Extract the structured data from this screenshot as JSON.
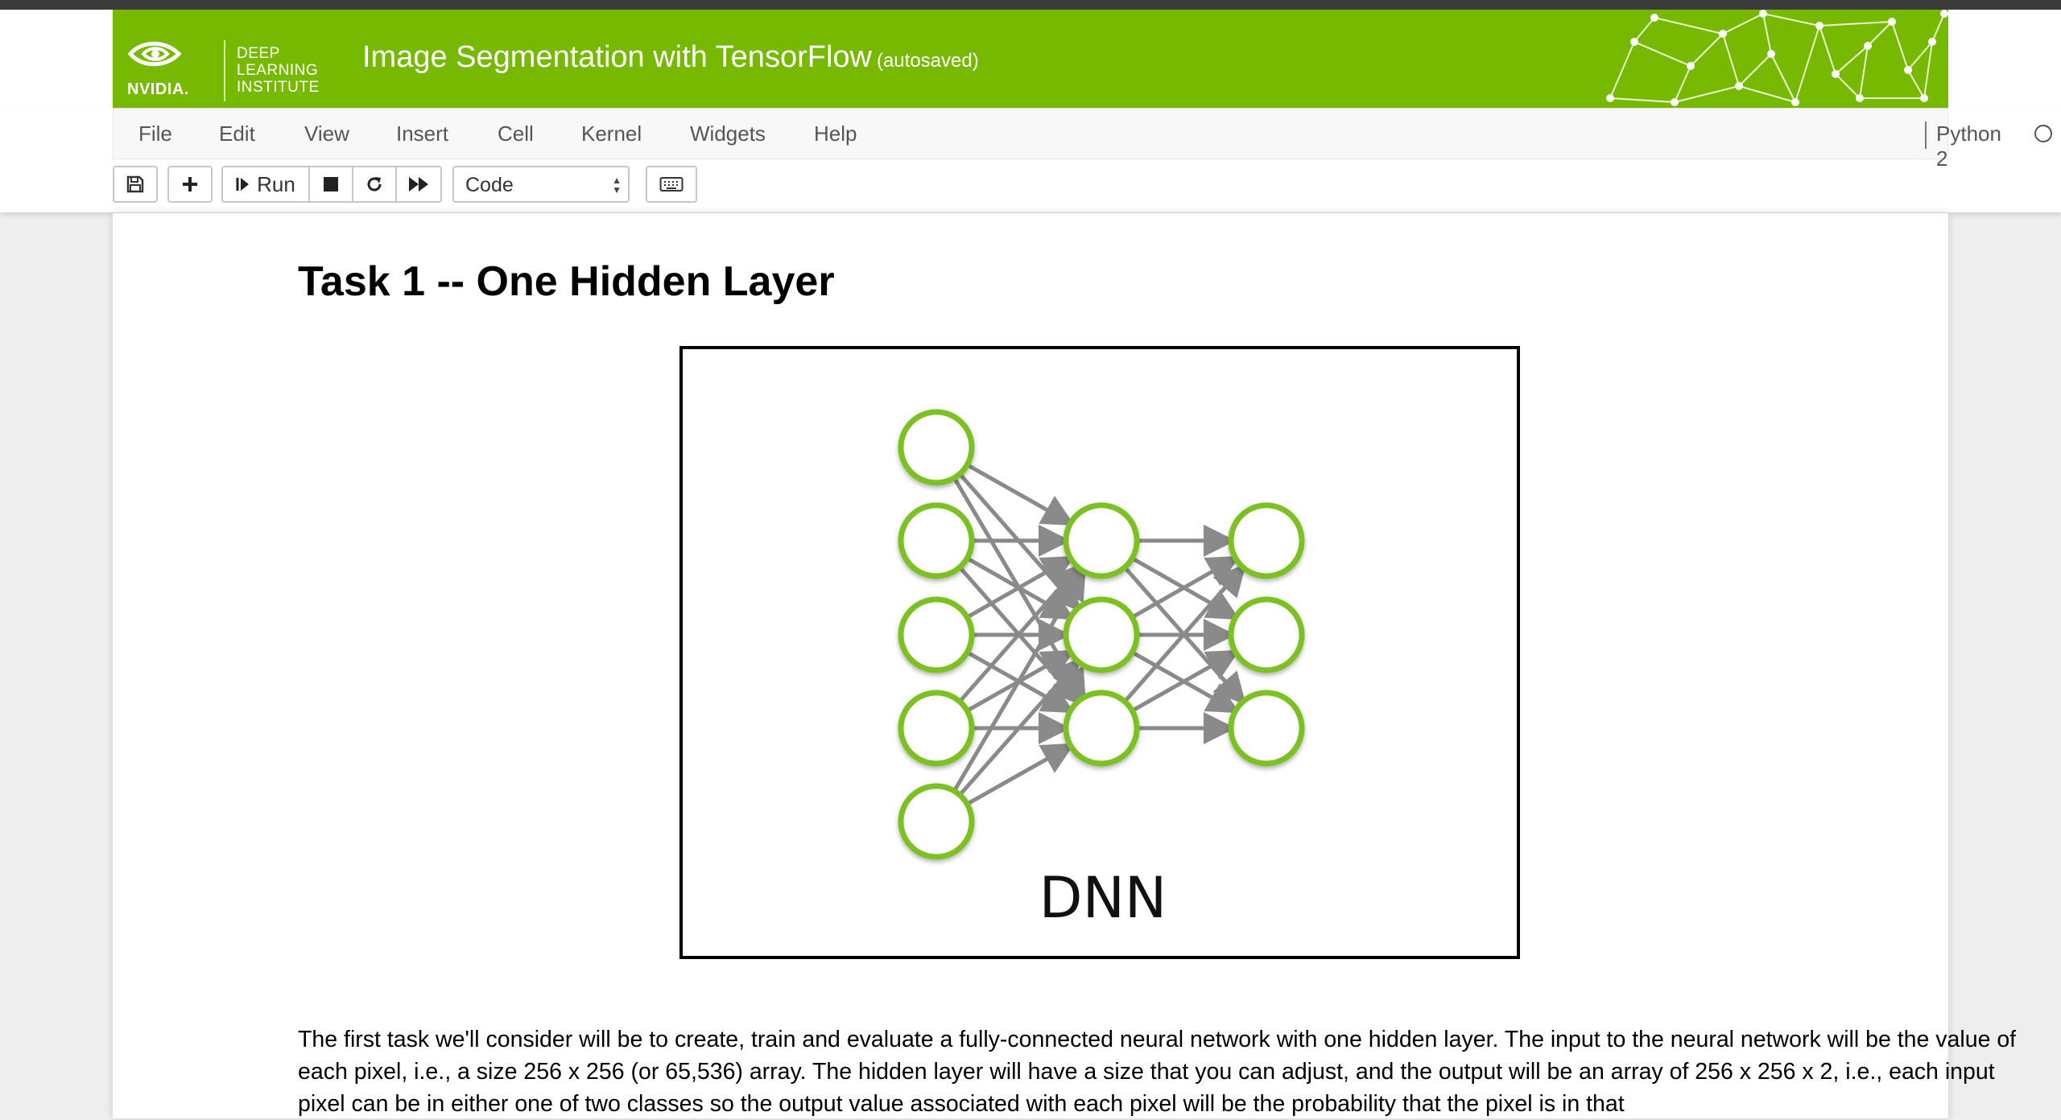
{
  "header": {
    "logo_wordmark": "NVIDIA.",
    "logo_lines": [
      "DEEP",
      "LEARNING",
      "INSTITUTE"
    ],
    "notebook_title": "Image Segmentation with TensorFlow",
    "autosave_status": "(autosaved)"
  },
  "menu": {
    "items": [
      {
        "label": "File"
      },
      {
        "label": "Edit"
      },
      {
        "label": "View"
      },
      {
        "label": "Insert"
      },
      {
        "label": "Cell"
      },
      {
        "label": "Kernel"
      },
      {
        "label": "Widgets"
      },
      {
        "label": "Help"
      }
    ],
    "kernel_name": "Python 2"
  },
  "toolbar": {
    "run_label": "Run",
    "cell_type": "Code",
    "icons": [
      "save-icon",
      "plus-icon",
      "step-forward-icon",
      "stop-icon",
      "restart-icon",
      "fast-forward-icon",
      "keyboard-icon"
    ]
  },
  "content": {
    "heading": "Task 1 -- One Hidden Layer",
    "figure_label": "DNN",
    "network_layers": [
      5,
      3,
      3
    ],
    "paragraph": "The first task we'll consider will be to create, train and evaluate a fully-connected neural network with one hidden layer. The input to the neural network will be the value of each pixel, i.e., a size 256 x 256 (or 65,536) array. The hidden layer will have a size that you can adjust, and the output will be an array of 256 x 256 x 2, i.e., each input pixel can be in either one of two classes so the output value associated with each pixel will be the probability that the pixel is in that"
  },
  "colors": {
    "brand_green": "#76b900",
    "node_green": "#7cc121",
    "arrow_gray": "#8a8a8a"
  }
}
